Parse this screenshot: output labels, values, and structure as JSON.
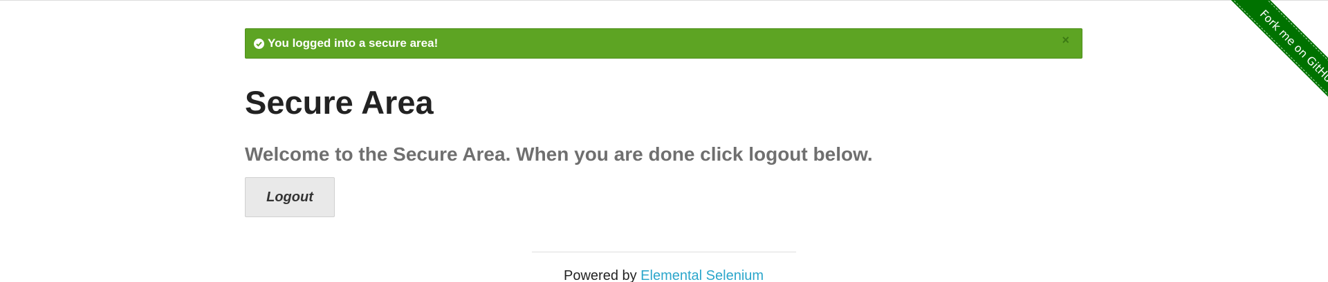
{
  "flash": {
    "message": "You logged into a secure area!",
    "close_label": "×",
    "icon": "check-circle-icon",
    "color": "#5da423"
  },
  "page": {
    "title": "Secure Area",
    "subheader": "Welcome to the Secure Area. When you are done click logout below."
  },
  "logout_button": {
    "label": "Logout"
  },
  "footer": {
    "prefix": "Powered by ",
    "link_text": "Elemental Selenium"
  },
  "ribbon": {
    "label": "Fork me on GitHub",
    "color": "#007200"
  }
}
